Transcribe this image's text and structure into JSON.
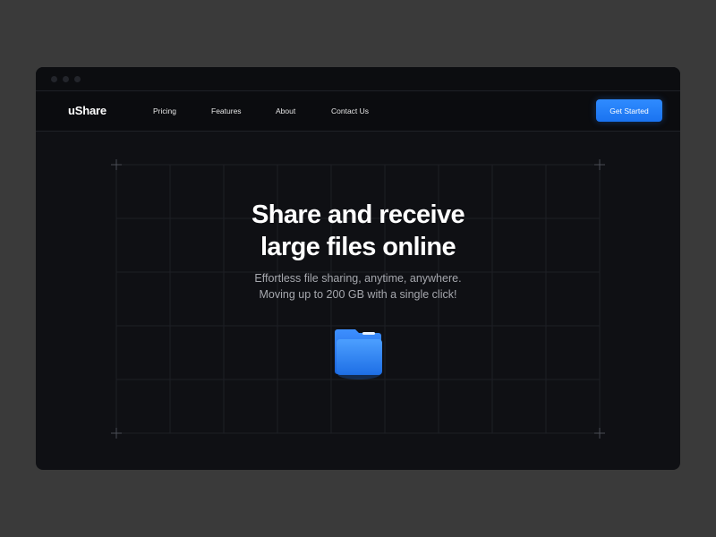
{
  "window": {
    "controls": [
      "close",
      "minimize",
      "maximize"
    ]
  },
  "nav": {
    "logo": "uShare",
    "links": [
      "Pricing",
      "Features",
      "About",
      "Contact Us"
    ],
    "cta_label": "Get Started"
  },
  "hero": {
    "title_line1": "Share and receive",
    "title_line2": "large files online",
    "subtitle_line1": "Effortless file sharing, anytime, anywhere.",
    "subtitle_line2": "Moving up to 200 GB with a single click!",
    "icon": "folder-icon"
  },
  "colors": {
    "page_bg": "#3a3a3a",
    "window_bg": "#0f1014",
    "accent": "#1f7bff",
    "grid": "#1d1f25",
    "subtitle": "#a6a8ae"
  }
}
